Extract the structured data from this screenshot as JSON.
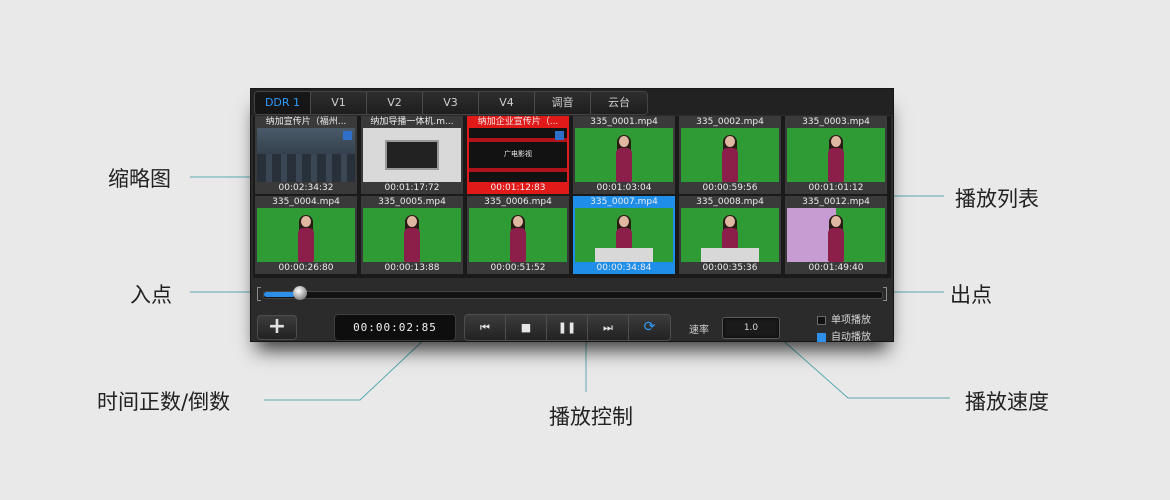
{
  "tabs": [
    "DDR 1",
    "V1",
    "V2",
    "V3",
    "V4",
    "调音",
    "云台"
  ],
  "thumbnails": [
    {
      "title": "纳加宣传片（福州...",
      "time": "00:02:34:32",
      "style": "crowd",
      "state": "normal"
    },
    {
      "title": "纳加导播一体机.m...",
      "time": "00:01:17:72",
      "style": "slide",
      "state": "normal"
    },
    {
      "title": "纳加企业宣传片（...",
      "time": "00:01:12:83",
      "style": "red-screen",
      "state": "selected-red",
      "overlay_text": "广电影视"
    },
    {
      "title": "335_0001.mp4",
      "time": "00:01:03:04",
      "style": "green",
      "state": "normal"
    },
    {
      "title": "335_0002.mp4",
      "time": "00:00:59:56",
      "style": "green",
      "state": "normal"
    },
    {
      "title": "335_0003.mp4",
      "time": "00:01:01:12",
      "style": "green",
      "state": "normal"
    },
    {
      "title": "335_0004.mp4",
      "time": "00:00:26:80",
      "style": "green",
      "state": "normal"
    },
    {
      "title": "335_0005.mp4",
      "time": "00:00:13:88",
      "style": "green",
      "state": "normal"
    },
    {
      "title": "335_0006.mp4",
      "time": "00:00:51:52",
      "style": "green",
      "state": "normal"
    },
    {
      "title": "335_0007.mp4",
      "time": "00:00:34:84",
      "style": "green-desk",
      "state": "selected-blue"
    },
    {
      "title": "335_0008.mp4",
      "time": "00:00:35:36",
      "style": "green-desk",
      "state": "normal"
    },
    {
      "title": "335_0012.mp4",
      "time": "00:01:49:40",
      "style": "purple",
      "state": "normal"
    }
  ],
  "scrubber": {
    "progress": 0.05
  },
  "timecode": "00:00:02:85",
  "controls": {
    "prev": "⏮",
    "stop": "■",
    "pause": "❚❚",
    "next": "⏭",
    "loop": "⟳"
  },
  "rate": {
    "label": "速率",
    "value": "1.0"
  },
  "play_options": [
    {
      "label": "单项播放",
      "checked": false
    },
    {
      "label": "自动播放",
      "checked": true
    }
  ],
  "callouts": {
    "thumbnail": "缩略图",
    "playlist": "播放列表",
    "in_point": "入点",
    "out_point": "出点",
    "time": "时间正数/倒数",
    "control": "播放控制",
    "speed": "播放速度"
  },
  "colors": {
    "accent": "#2e8fe8",
    "selected_red": "#e01919",
    "leader_line": "#5aa9b0"
  }
}
